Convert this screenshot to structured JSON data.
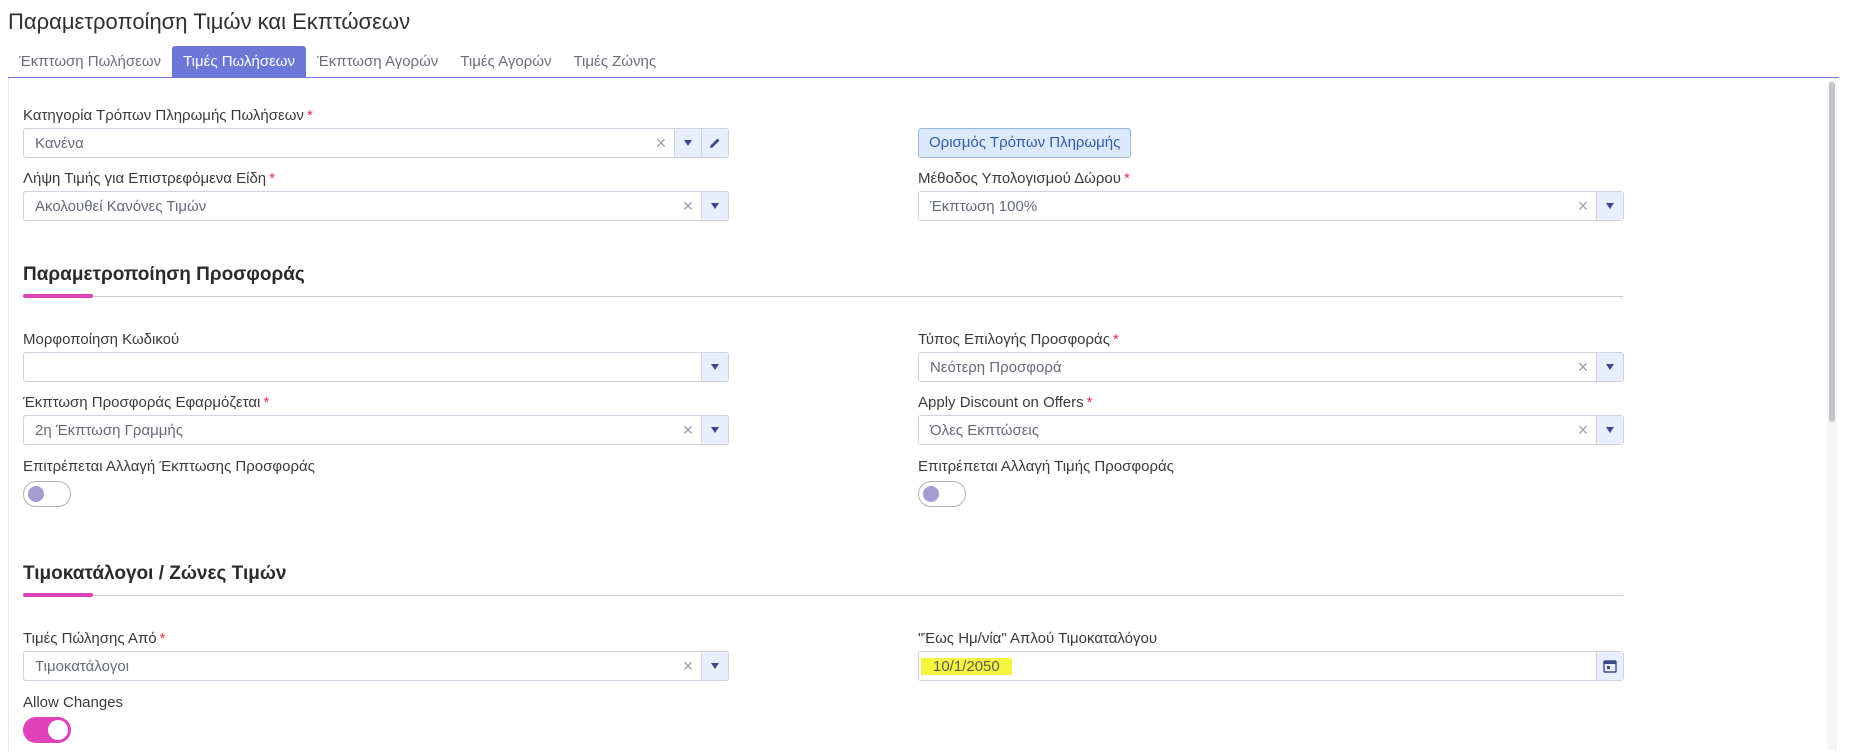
{
  "page": {
    "title": "Παραμετροποίηση Τιμών και Εκπτώσεων"
  },
  "tabs": [
    {
      "label": "Έκπτωση Πωλήσεων",
      "active": false
    },
    {
      "label": "Τιμές Πωλήσεων",
      "active": true
    },
    {
      "label": "Έκπτωση Αγορών",
      "active": false
    },
    {
      "label": "Τιμές Αγορών",
      "active": false
    },
    {
      "label": "Τιμές Ζώνης",
      "active": false
    }
  ],
  "fields": {
    "payment_category": {
      "label": "Κατηγορία Τρόπων Πληρωμής Πωλήσεων",
      "required": "*",
      "value": "Κανένα"
    },
    "define_payment_button": "Ορισμός Τρόπων Πληρωμής",
    "returned_items_price": {
      "label": "Λήψη Τιμής για Επιστρεφόμενα Είδη",
      "required": "*",
      "value": "Ακολουθεί Κανόνες Τιμών"
    },
    "gift_calc_method": {
      "label": "Μέθοδος Υπολογισμού Δώρου",
      "required": "*",
      "value": "Έκπτωση 100%"
    }
  },
  "offer_section": {
    "title": "Παραμετροποίηση Προσφοράς",
    "code_format": {
      "label": "Μορφοποίηση Κωδικού",
      "value": ""
    },
    "offer_selection_type": {
      "label": "Τύπος Επιλογής Προσφοράς",
      "required": "*",
      "value": "Νεότερη Προσφορά"
    },
    "offer_discount_applied": {
      "label": "Έκπτωση Προσφοράς Εφαρμόζεται",
      "required": "*",
      "value": "2η Έκπτωση Γραμμής"
    },
    "apply_discount_on_offers": {
      "label": "Apply Discount on Offers",
      "required": "*",
      "value": "Όλες Εκπτώσεις"
    },
    "allow_change_offer_discount": {
      "label": "Επιτρέπεται Αλλαγή Έκπτωσης Προσφοράς",
      "on": false
    },
    "allow_change_offer_price": {
      "label": "Επιτρέπεται Αλλαγή Τιμής Προσφοράς",
      "on": false
    }
  },
  "pricelist_section": {
    "title": "Τιμοκατάλογοι / Ζώνες Τιμών",
    "sale_prices_from": {
      "label": "Τιμές Πώλησης Από",
      "required": "*",
      "value": "Τιμοκατάλογοι"
    },
    "until_date": {
      "label": "\"Έως Ημ/νία\" Απλού Τιμοκαταλόγου",
      "value": "10/1/2050"
    },
    "allow_changes": {
      "label": "Allow Changes",
      "on": true
    }
  },
  "colors": {
    "accent": "#6b78d8",
    "pink": "#e043b8",
    "required": "#e0324a",
    "highlight": "#f5f541"
  },
  "icons": {
    "clear": "close-icon",
    "dropdown": "chevron-down-icon",
    "edit": "pencil-icon",
    "calendar": "calendar-icon"
  }
}
